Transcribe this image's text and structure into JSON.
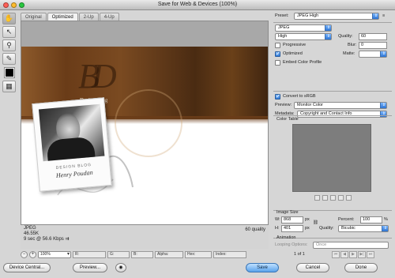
{
  "window": {
    "title": "Save for Web & Devices (100%)",
    "colors": {
      "close": "#ff5f57",
      "minimize": "#febc2e",
      "zoom": "#28c840"
    }
  },
  "toolbox": {
    "tools": [
      {
        "name": "hand-tool",
        "glyph": "✋"
      },
      {
        "name": "slice-select-tool",
        "glyph": "↖"
      },
      {
        "name": "zoom-tool",
        "glyph": "🔍"
      },
      {
        "name": "eyedropper-tool",
        "glyph": "✎"
      }
    ],
    "eyedropper_color": "#000000",
    "toggle_slices_glyph": "▦"
  },
  "tabs": [
    "Original",
    "Optimized",
    "2-Up",
    "4-Up"
  ],
  "active_tab": "Optimized",
  "preview": {
    "logo_text": "Design Blog",
    "logo_mark": "BD",
    "polaroid_caption_small": "DESIGN BLOG",
    "polaroid_caption_name": "Henry Poudan"
  },
  "image_info": {
    "format": "JPEG",
    "size": "46.55K",
    "time": "9 sec @ 56.6 Kbps",
    "quality_note": "60 quality"
  },
  "status_bar": {
    "zoom": "100%",
    "r_label": "R:",
    "g_label": "G:",
    "b_label": "B:",
    "alpha_label": "Alpha:",
    "hex_label": "Hex:",
    "index_label": "Index:"
  },
  "footer": {
    "device_central": "Device Central...",
    "preview": "Preview...",
    "save": "Save",
    "cancel": "Cancel",
    "done": "Done"
  },
  "settings": {
    "preset_label": "Preset:",
    "preset_value": "JPEG High",
    "format_value": "JPEG",
    "quality_level": "High",
    "quality_label": "Quality:",
    "quality_value": "60",
    "progressive_label": "Progressive",
    "progressive_checked": false,
    "blur_label": "Blur:",
    "blur_value": "0",
    "optimized_label": "Optimized",
    "optimized_checked": true,
    "matte_label": "Matte:",
    "embed_label": "Embed Color Profile",
    "embed_checked": false,
    "convert_label": "Convert to sRGB",
    "convert_checked": true,
    "preview_label": "Preview:",
    "preview_value": "Monitor Color",
    "metadata_label": "Metadata:",
    "metadata_value": "Copyright and Contact Info"
  },
  "color_table": {
    "title": "Color Table"
  },
  "image_size": {
    "title": "Image Size",
    "w_label": "W:",
    "w_value": "868",
    "h_label": "H:",
    "h_value": "401",
    "unit": "px",
    "percent_label": "Percent:",
    "percent_value": "100",
    "percent_unit": "%",
    "quality_label": "Quality:",
    "quality_value": "Bicubic"
  },
  "animation": {
    "title": "Animation",
    "looping_label": "Looping Options:",
    "looping_value": "Once",
    "frame_counter": "1 of 1"
  }
}
